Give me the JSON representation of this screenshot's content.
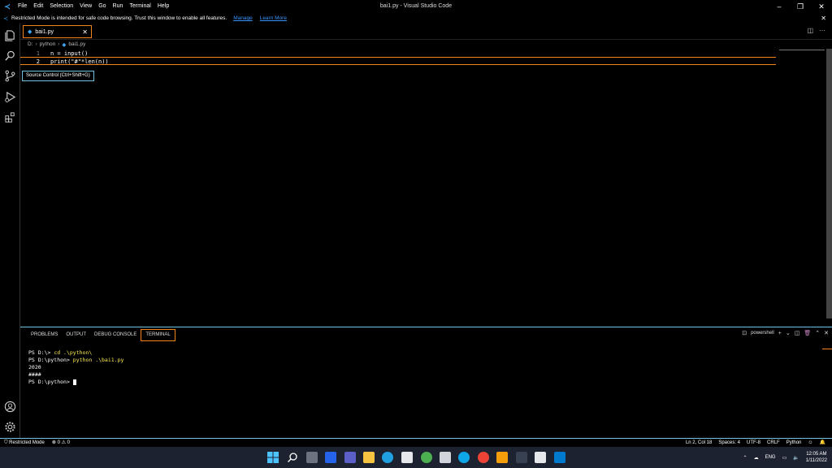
{
  "titlebar": {
    "menu": [
      "File",
      "Edit",
      "Selection",
      "View",
      "Go",
      "Run",
      "Terminal",
      "Help"
    ],
    "title": "bai1.py - Visual Studio Code"
  },
  "banner": {
    "message": "Restricted Mode is intended for safe code browsing. Trust this window to enable all features.",
    "manage": "Manage",
    "learn_more": "Learn More"
  },
  "tabs": [
    {
      "label": "bai1.py"
    }
  ],
  "breadcrumb": {
    "drive": "D:",
    "folder": "python",
    "file": "bai1.py"
  },
  "editor": {
    "lines": [
      {
        "num": "1",
        "code": "n = input()"
      },
      {
        "num": "2",
        "code": "print(\"#\"*len(n))"
      }
    ]
  },
  "tooltip": "Source Control (Ctrl+Shift+G)",
  "panel": {
    "tabs": [
      "PROBLEMS",
      "OUTPUT",
      "DEBUG CONSOLE",
      "TERMINAL"
    ],
    "shell": "powershell",
    "terminal": {
      "line1_prompt": "PS D:\\> ",
      "line1_cmd": "cd .\\python\\",
      "line2_prompt": "PS D:\\python> ",
      "line2_cmd": "python .\\bai1.py",
      "line3": "2020",
      "line4": "####",
      "line5_prompt": "PS D:\\python> "
    }
  },
  "statusbar": {
    "restricted": "Restricted Mode",
    "problems": "0",
    "warnings": "0",
    "position": "Ln 2, Col 18",
    "spaces": "Spaces: 4",
    "encoding": "UTF-8",
    "eol": "CRLF",
    "language": "Python"
  },
  "taskbar": {
    "lang": "ENG",
    "time": "12:05 AM",
    "date": "1/11/2022"
  },
  "colors": {
    "accent_border": "#f38518",
    "focus_border": "#6fc3df",
    "python_icon": "#3ea6f5"
  }
}
